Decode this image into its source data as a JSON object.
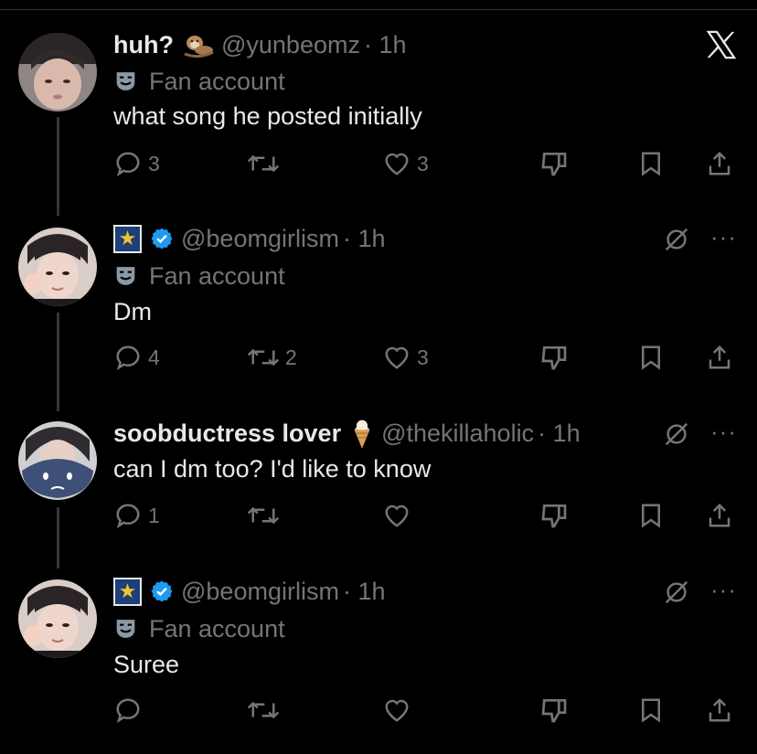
{
  "colors": {
    "background": "#000000",
    "text": "#e7e9ea",
    "muted": "#71767b",
    "verified": "#1d9bf0",
    "thread_line": "#333639"
  },
  "app_icon": "x-logo-icon",
  "tweets": [
    {
      "name": "huh?",
      "emoji": "otter-emoji",
      "handle": "@yunbeomz",
      "time": "· 1h",
      "badge": "Fan account",
      "text": "what song he posted initially",
      "replies": "3",
      "retweets": "",
      "likes": "3"
    },
    {
      "name": "",
      "emoji": "shooting-star-flag",
      "verified": true,
      "handle": "@beomgirlism",
      "time": "· 1h",
      "badge": "Fan account",
      "text": "Dm",
      "replies": "4",
      "retweets": "2",
      "likes": "3"
    },
    {
      "name": "soobductress lover",
      "emoji": "ice-cream-emoji",
      "handle": "@thekillaholic",
      "time": "· 1h",
      "text": "can I dm too? I'd like to know",
      "replies": "1",
      "retweets": "",
      "likes": ""
    },
    {
      "name": "",
      "emoji": "shooting-star-flag",
      "verified": true,
      "handle": "@beomgirlism",
      "time": "· 1h",
      "badge": "Fan account",
      "text": "Suree",
      "replies": "",
      "retweets": "",
      "likes": ""
    }
  ]
}
